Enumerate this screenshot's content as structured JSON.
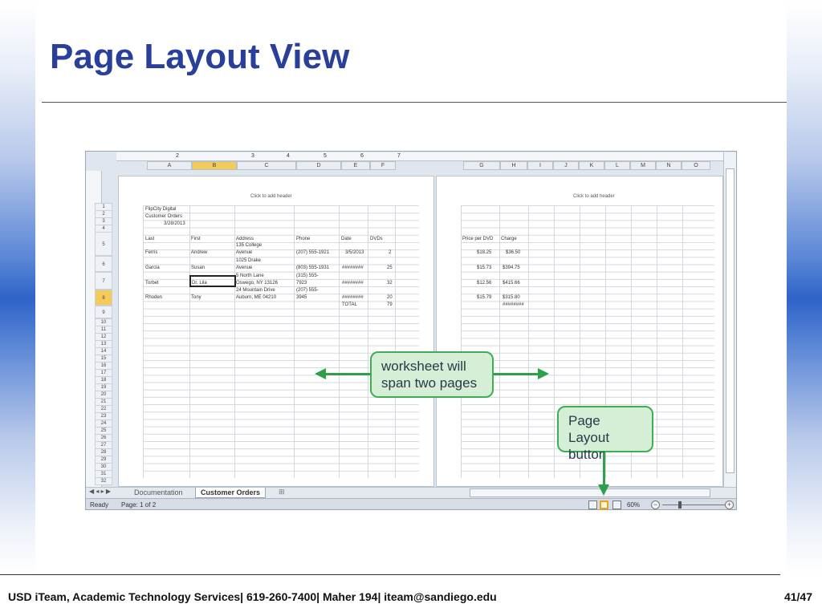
{
  "slide": {
    "title": "Page Layout View",
    "footer": "USD iTeam, Academic Technology Services| 619-260-7400| Maher 194| iteam@sandiego.edu",
    "page_number": "41/47"
  },
  "excel": {
    "columns_page1": [
      "A",
      "B",
      "C",
      "D",
      "E",
      "F"
    ],
    "columns_page2": [
      "G",
      "H",
      "I",
      "J",
      "K",
      "L",
      "M",
      "N",
      "O"
    ],
    "header_hint": "Click to add header",
    "page1_lines": {
      "r1": "FlipCity Digital",
      "r2": "Customer Orders",
      "r3": "3/28/2013",
      "headers": [
        "Last",
        "First",
        "Address",
        "Phone",
        "Date",
        "DVDs"
      ],
      "farris": [
        "Ferris",
        "Andrew",
        "135 College",
        "Avenue",
        "(207) 555-1921",
        "3/5/2013",
        "2"
      ],
      "garcia": [
        "Garcia",
        "Susan",
        "1025 Drake",
        "Avenue",
        "(803) 555-1931",
        "########",
        "25"
      ],
      "torbet": [
        "Torbet",
        "Dr. Lila",
        "5 North Lane",
        "Oswego, NY 13126",
        "(315) 555-",
        "7923",
        "########",
        "32"
      ],
      "rhoden": [
        "Rhoden",
        "Tony",
        "24 Mountain Drive",
        "Auburn, ME 04210",
        "(207) 555-",
        "3945",
        "########",
        "20"
      ],
      "total": [
        "TOTAL",
        "79"
      ]
    },
    "page2_lines": {
      "headers": [
        "Price per DVD",
        "Charge"
      ],
      "values": [
        [
          "$18.25",
          "$36.50"
        ],
        [
          "$15.73",
          "$394.75"
        ],
        [
          "$12.56",
          "$415.66"
        ],
        [
          "$15.79",
          "$315.80"
        ],
        [
          "",
          "########"
        ]
      ]
    },
    "sheet_tabs": [
      "Documentation",
      "Customer Orders"
    ],
    "status": {
      "ready": "Ready",
      "page": "Page: 1 of 2",
      "zoom": "60%"
    }
  },
  "callouts": {
    "span": "worksheet will\nspan two pages",
    "button_label": "Page Layout\nbutton"
  },
  "colors": {
    "title": "#2a3f9a",
    "callout_fill": "#d5efd6",
    "callout_border": "#3fae52",
    "arrow": "#2ea04a",
    "selected": "#f4cb5a"
  }
}
